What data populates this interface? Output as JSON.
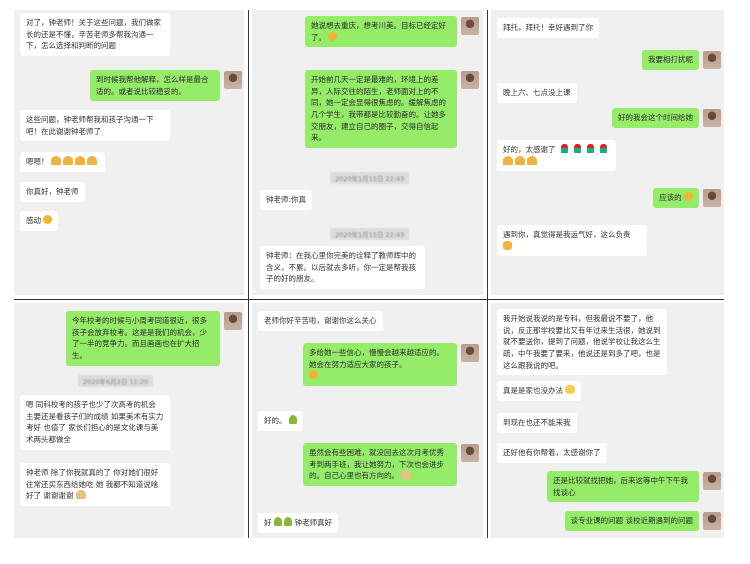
{
  "panels": {
    "p1": {
      "m1": "对了，钟老师！关于这些问题，我们做家长的还是不懂，辛苦老师多帮我沟通一下，怎么选择和判断的问题",
      "m2": "到时候我帮他解释，怎么样是最合适的。或者说比较稳妥的。",
      "m3": "这些问题，钟老师帮我和孩子沟通一下吧！在此谢谢钟老师了",
      "m4": "嗯嗯！",
      "m5": "你真好，钟老师",
      "m6": "感动"
    },
    "p2": {
      "m1": "她说想去重庆，想考川美。目标已经定好了。",
      "m2": "开始前几天一定是最难的，环境上的差异，人际交往的陌生，老师面对上的不同，她一定会显得很焦虑的。缓解焦虑的几个学生，我带都是比较勤奋的。让她多交朋友，建立自己的圈子，交得自信起来。",
      "ts1": "2020年1月15日 22:43",
      "m3": "钟老师:你真",
      "ts2": "2020年1月15日 22:43",
      "m4": "钟老师：在我心里你完美的诠释了教师辉中的含义，不累。以后就去多听，你一定是帮我孩子的好的朋友。"
    },
    "p3": {
      "m1": "拜托，拜托！幸好遇到了你",
      "m2": "我要相打扰呢",
      "m3": "晚上六、七点没上课",
      "m4": "好的我会这个时间给她",
      "m5": "好的，太感谢了",
      "m6": "应该的",
      "m7": "遇到你，真觉得是我运气好，这么负责"
    },
    "p4": {
      "m1": "今年校考的时候与小周考同道很近，很多孩子会放弃校考。这是是我们的机会，少了一半的竞争力。而且画画也在扩大招生。",
      "ts1": "2020年6月2日 11:20",
      "m2": "嗯 同科校考的孩子也少了次高考的机会 主要还是看孩子们的成绩 如果美术有实力考好 也值了 家长们担心的是文化课与美术两头都做全",
      "m3": "钟老师 除了你我就真的了 你对她们很好 往常还买东西给她吃 她 我都不知道说啥好了 谢谢谢谢"
    },
    "p5": {
      "m1": "老师你好辛苦啦，谢谢你这么关心",
      "m2": "多给她一些信心，慢慢会越来越适应的。她会在努力适应大家的孩子。",
      "m3": "好的。",
      "m4": "虽然会有些困难，就没回去这次月考优秀考到两手班，我让她努力，下次也会进步的。自己心里也有方向的。",
      "m5": "好",
      "m6": "钟老师真好"
    },
    "p6": {
      "m1": "我开始说我说的是专科，但我最说不要了，他说，反正那学校要比又有年过来生活很，她说到就不要送你，提到了问题，他说学校让我这么生疏，中午我要了要来，他说还是到多了吧，也是这么跟我说的吧。",
      "m2": "真是是家也没办法",
      "m3": "到现在也还不能来我",
      "m4": "还好他有你帮着，太感谢你了",
      "m5": "还是比较就找把她，后来这等中午下午我找谈心",
      "m6": "谈专业课的问题 谈校近期遇到的问题"
    }
  },
  "colors": {
    "bubble_green": "#95ec69",
    "bubble_white": "#ffffff",
    "panel_bg": "#f0f0f0",
    "divider": "#333333"
  }
}
